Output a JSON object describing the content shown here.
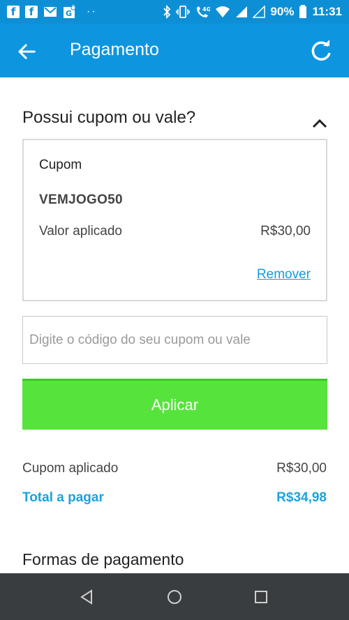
{
  "status_bar": {
    "battery": "90%",
    "time": "11:31",
    "network": "4G",
    "icons": [
      "facebook-icon",
      "facebook-icon",
      "mail-icon",
      "google-maps-icon",
      "more-dots-icon",
      "bluetooth-icon",
      "vibrate-icon",
      "call-4g-icon",
      "wifi-icon",
      "signal-icon",
      "signal-empty-icon",
      "battery-icon"
    ]
  },
  "app_bar": {
    "title": "Pagamento",
    "back_icon": "arrow-back-icon",
    "refresh_icon": "refresh-icon"
  },
  "coupon_section": {
    "title": "Possui cupom ou vale?",
    "collapse_icon": "chevron-up-icon",
    "card": {
      "label": "Cupom",
      "code": "VEMJOGO50",
      "applied_label": "Valor aplicado",
      "applied_value": "R$30,00",
      "remove_label": "Remover"
    },
    "input": {
      "placeholder": "Digite o código do seu cupom ou vale",
      "value": ""
    },
    "apply_label": "Aplicar"
  },
  "summary": {
    "coupon_label": "Cupom aplicado",
    "coupon_value": "R$30,00",
    "total_label": "Total a pagar",
    "total_value": "R$34,98"
  },
  "payment_section": {
    "title": "Formas de pagamento"
  },
  "nav_bar": {
    "icons": [
      "back-triangle-icon",
      "home-circle-icon",
      "recents-square-icon"
    ]
  },
  "colors": {
    "primary": "#0d95e0",
    "accent_green": "#56e43c",
    "link_blue": "#1a9ad6",
    "total_blue": "#1aa3dc",
    "nav_bar": "#3a3d40"
  }
}
